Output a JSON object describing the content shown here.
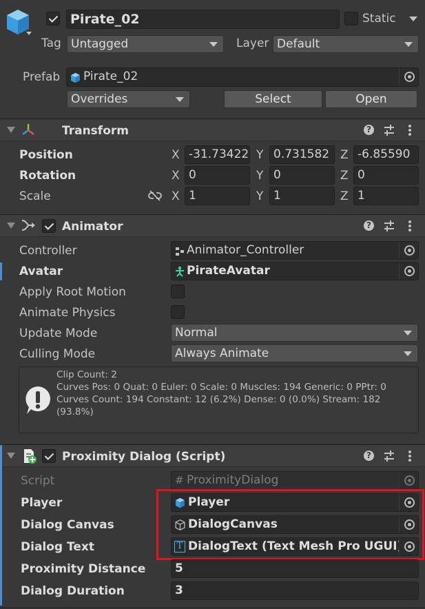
{
  "object": {
    "name": "Pirate_02",
    "static_label": "Static",
    "tag_label": "Tag",
    "tag_value": "Untagged",
    "layer_label": "Layer",
    "layer_value": "Default",
    "prefab_label": "Prefab",
    "prefab_value": "Pirate_02",
    "overrides_label": "Overrides",
    "select_label": "Select",
    "open_label": "Open"
  },
  "transform": {
    "title": "Transform",
    "position_label": "Position",
    "rotation_label": "Rotation",
    "scale_label": "Scale",
    "axis_x": "X",
    "axis_y": "Y",
    "axis_z": "Z",
    "pos_x": "-31.73422",
    "pos_y": "0.731582",
    "pos_z": "-6.85590",
    "rot_x": "0",
    "rot_y": "0",
    "rot_z": "0",
    "scale_x": "1",
    "scale_y": "1",
    "scale_z": "1"
  },
  "animator": {
    "title": "Animator",
    "controller_label": "Controller",
    "controller_value": "Animator_Controller",
    "avatar_label": "Avatar",
    "avatar_value": "PirateAvatar",
    "apply_root_label": "Apply Root Motion",
    "animate_physics_label": "Animate Physics",
    "update_mode_label": "Update Mode",
    "update_mode_value": "Normal",
    "culling_label": "Culling Mode",
    "culling_value": "Always Animate",
    "info_line1": "Clip Count: 2",
    "info_line2": "Curves Pos: 0 Quat: 0 Euler: 0 Scale: 0 Muscles: 194 Generic: 0 PPtr: 0",
    "info_line3": "Curves Count: 194 Constant: 12 (6.2%) Dense: 0 (0.0%) Stream: 182",
    "info_line4": "(93.8%)"
  },
  "proximity": {
    "title": "Proximity Dialog (Script)",
    "script_label": "Script",
    "script_value": "ProximityDialog",
    "player_label": "Player",
    "player_value": "Player",
    "canvas_label": "Dialog Canvas",
    "canvas_value": "DialogCanvas",
    "text_label": "Dialog Text",
    "text_value": "DialogText (Text Mesh Pro UGUI)",
    "distance_label": "Proximity Distance",
    "distance_value": "5",
    "duration_label": "Dialog Duration",
    "duration_value": "3"
  },
  "colors": {
    "accent": "#4c8fd4",
    "highlight": "#e0141c",
    "panel": "#383838"
  }
}
